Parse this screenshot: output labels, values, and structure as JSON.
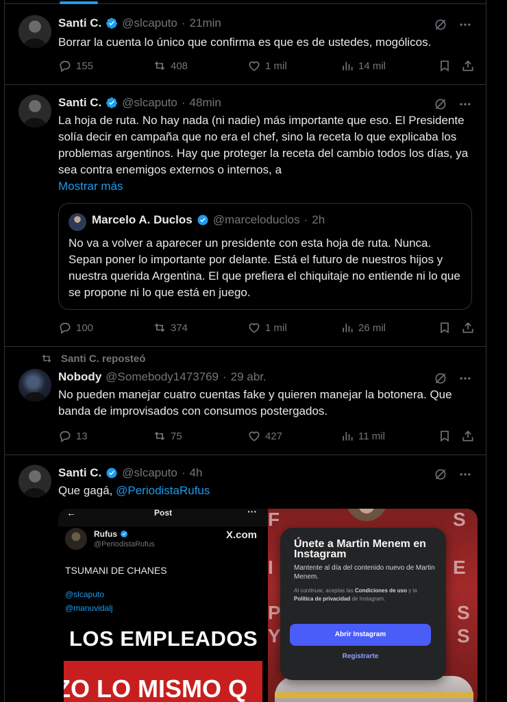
{
  "tweets": [
    {
      "name": "Santi C.",
      "handle": "@slcaputo",
      "dot": "·",
      "time": "21min",
      "text": "Borrar la cuenta lo único que confirma es que es de ustedes, mogólicos.",
      "replies": "155",
      "reposts": "408",
      "likes": "1 mil",
      "views": "14 mil"
    },
    {
      "name": "Santi C.",
      "handle": "@slcaputo",
      "dot": "·",
      "time": "48min",
      "text": "La hoja de ruta. No hay nada (ni nadie) más importante que eso. El Presidente solía decir en campaña que no era el chef, sino la receta lo que explicaba los problemas argentinos. Hay que proteger la receta del cambio todos los días, ya sea contra enemigos externos o internos, a",
      "show_more": "Mostrar más",
      "quote": {
        "name": "Marcelo A. Duclos",
        "handle": "@marceloduclos",
        "dot": "·",
        "time": "2h",
        "text": "No va a volver a aparecer un presidente con esta hoja de ruta. Nunca. Sepan poner lo importante por delante. Está el futuro de nuestros hijos y nuestra querida Argentina. El que prefiera el chiquitaje no entiende ni lo que se propone ni lo que está en juego."
      },
      "replies": "100",
      "reposts": "374",
      "likes": "1 mil",
      "views": "26 mil"
    },
    {
      "repost_label": "Santi C. reposteó",
      "name": "Nobody",
      "handle": "@Somebody1473769",
      "dot": "·",
      "time": "29 abr.",
      "text": "No pueden manejar cuatro cuentas fake y quieren manejar la botonera. Que banda de improvisados con consumos postergados.",
      "replies": "13",
      "reposts": "75",
      "likes": "427",
      "views": "11 mil"
    },
    {
      "name": "Santi C.",
      "handle": "@slcaputo",
      "dot": "·",
      "time": "4h",
      "text_prefix": "Que gagá, ",
      "mention": "@PeriodistaRufus",
      "media": {
        "left": {
          "header": "Post",
          "back": "←",
          "dots": "···",
          "name": "Rufus",
          "handle": "@PeriodistaRufus",
          "xcom": "X.com",
          "text": "TSUMANI DE CHANES",
          "mention1": "@slcaputo",
          "mention2": "@manuvidalj",
          "big1": "LOS EMPLEADOS",
          "big2": "ZO LO MISMO Q"
        },
        "right": {
          "title": "Únete a Martin Menem en Instagram",
          "subtitle": "Mantente al día del contenido nuevo de Martin Menem.",
          "legal_prefix": "Al continuar, aceptas las ",
          "legal_terms": "Condiciones de uso",
          "legal_mid": " y la ",
          "legal_privacy": "Política de privacidad",
          "legal_suffix": " de Instagram.",
          "button": "Abrir Instagram",
          "register": "Registrarte",
          "bg_letters": [
            "F",
            "S",
            "I",
            "E",
            "PA",
            "S",
            "Y",
            "S"
          ]
        }
      }
    }
  ],
  "colors": {
    "background": "#000000",
    "accent": "#1d9bf0",
    "muted": "#71767b",
    "border": "#2f3336",
    "instagram_button": "#4a5df9"
  },
  "icons": [
    "verified-badge-icon",
    "grok-icon",
    "more-icon",
    "reply-icon",
    "repost-icon",
    "like-icon",
    "views-icon",
    "bookmark-icon",
    "share-icon"
  ]
}
